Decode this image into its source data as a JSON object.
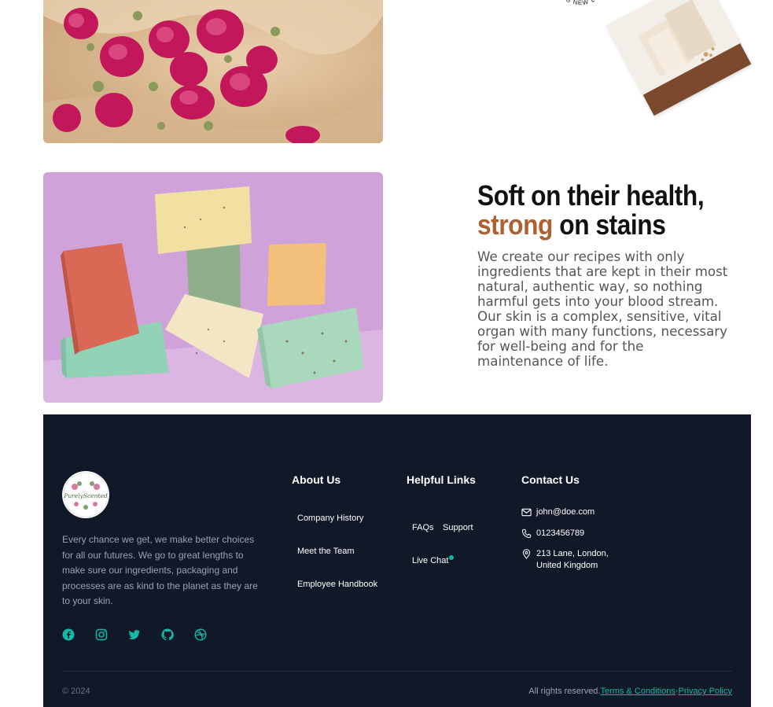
{
  "hero": {
    "headline_part1": "Soft on their health,",
    "headline_accent": "strong",
    "headline_part2": " on stains",
    "body": "We create our recipes with only ingredients that are kept in their most natural, authentic way, so nothing harmful gets into your blood stream. Our skin is a complex, sensitive, vital organ with many functions, necessary for well-being and for the maintenance of life."
  },
  "stamp_text": "LOOKING NEW LO",
  "footer": {
    "logo_text": "PurelyScented",
    "about_text": "Every chance we get, we make better choices for all our futures. We go to great lengths to make sure our ingredients, packaging and processes are as kind to the planet as they are to your skin.",
    "socials": [
      "facebook-icon",
      "instagram-icon",
      "twitter-icon",
      "github-icon",
      "dribbble-icon"
    ],
    "about_us": {
      "title": "About Us",
      "links": [
        "Company History",
        "Meet the Team",
        "Employee Handbook"
      ]
    },
    "helpful_links": {
      "title": "Helpful Links",
      "links": [
        "FAQs",
        "Support",
        "Live Chat"
      ]
    },
    "contact": {
      "title": "Contact Us",
      "email": "john@doe.com",
      "phone": "0123456789",
      "address": "213 Lane, London, United Kingdom"
    },
    "copyright": "© 2024",
    "rights": "All rights reserved.",
    "terms": "Terms & Conditions",
    "separator": "·",
    "privacy": "Privacy Policy"
  },
  "colors": {
    "accent": "#b06030",
    "footer_bg": "#111827",
    "teal": "#14b8a6"
  }
}
